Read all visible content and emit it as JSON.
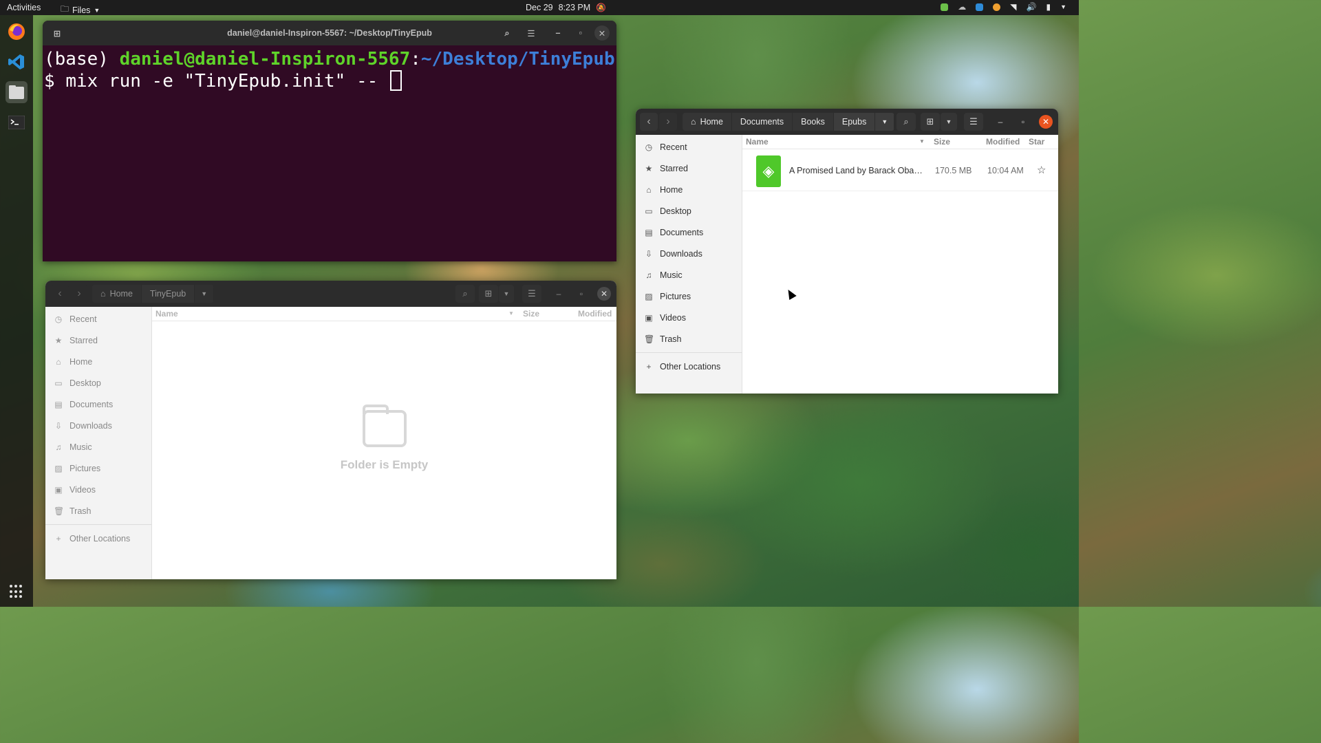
{
  "topbar": {
    "activities": "Activities",
    "app_menu": "Files",
    "date": "Dec 29",
    "time": "8:23 PM"
  },
  "terminal": {
    "title": "daniel@daniel-Inspiron-5567: ~/Desktop/TinyEpub",
    "env": "(base) ",
    "user_host": "daniel@daniel-Inspiron-5567",
    "colon": ":",
    "path": "~/Desktop/TinyEpub",
    "prompt": "$ ",
    "command": "mix run -e \"TinyEpub.init\" -- "
  },
  "files_back": {
    "crumbs": [
      "Home",
      "TinyEpub"
    ],
    "columns": {
      "name": "Name",
      "size": "Size",
      "modified": "Modified"
    },
    "sidebar": [
      "Recent",
      "Starred",
      "Home",
      "Desktop",
      "Documents",
      "Downloads",
      "Music",
      "Pictures",
      "Videos",
      "Trash"
    ],
    "other_locations": "Other Locations",
    "empty_text": "Folder is Empty"
  },
  "files_front": {
    "crumbs": [
      "Home",
      "Documents",
      "Books",
      "Epubs"
    ],
    "columns": {
      "name": "Name",
      "size": "Size",
      "modified": "Modified",
      "star": "Star"
    },
    "sidebar": [
      "Recent",
      "Starred",
      "Home",
      "Desktop",
      "Documents",
      "Downloads",
      "Music",
      "Pictures",
      "Videos",
      "Trash"
    ],
    "other_locations": "Other Locations",
    "files": [
      {
        "name": "A Promised Land by Barack Obam…",
        "size": "170.5 MB",
        "modified": "10:04 AM"
      }
    ]
  },
  "colors": {
    "terminal_bg": "#300a24",
    "prompt_user": "#5fd32a",
    "prompt_path": "#3d7fd8",
    "close_button": "#e95420",
    "epub_icon": "#4fc82a"
  },
  "icons": [
    "firefox-icon",
    "vscode-icon",
    "files-icon",
    "terminal-icon",
    "apps-grid-icon"
  ]
}
